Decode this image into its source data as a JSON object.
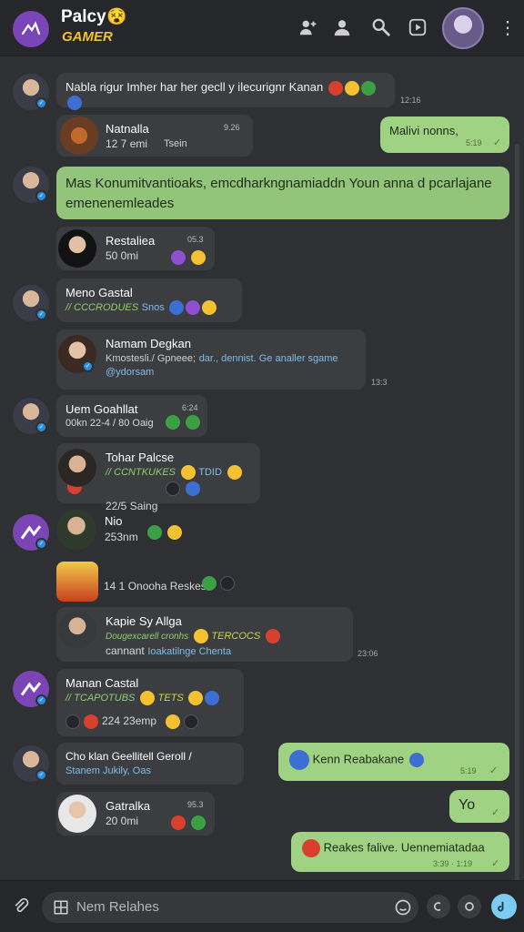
{
  "header": {
    "brand_line1": "Palcy",
    "brand_line2": "GAMER",
    "icons": [
      "add-group-icon",
      "profile-icon",
      "search-icon",
      "media-icon",
      "user-avatar",
      "more-icon"
    ]
  },
  "messages": [
    {
      "sender": "",
      "text": "Nabla rigur Imher har her gecll y ilecurignr Kanan",
      "time": "12:16"
    },
    {
      "sender": "Natnalla",
      "text": "12 7 emi",
      "extra": "Tsein",
      "time": "9.26"
    },
    {
      "sender": "",
      "text": "Malivi nonns,",
      "time": "5:19",
      "outgoing": true
    },
    {
      "sender": "",
      "text": "Mas Konumitvantioaks, emcdharkngnamiaddn Youn anna d pcarlajane emenenemleades",
      "time": ""
    },
    {
      "sender": "Restaliea",
      "text": "50 0mi",
      "time": "05.3"
    },
    {
      "sender": "Meno Gastal",
      "tag": "// CCCRODUES",
      "tag2": "Snos",
      "time": ""
    },
    {
      "sender": "Namam Degkan",
      "text": "Kmostesli./ Gpneee;",
      "link": "dar., dennist. Ge analler sgame",
      "handle": "@ydorsam",
      "time": "13:3"
    },
    {
      "sender": "Uem Goahllat",
      "text": "00kn 22-4 / 80 Oaig",
      "time": "6:24"
    },
    {
      "sender": "Tohar Palcse",
      "tag": "// CCNTKUKES",
      "tag2": "TDID",
      "text": "22/5 Saing",
      "time": ""
    },
    {
      "sender": "Nio",
      "text": "253nm",
      "time": ""
    },
    {
      "sender": "",
      "text": "14 1 Onooha Reskes",
      "time": ""
    },
    {
      "sender": "Kapie Sy Allga",
      "tag": "Dougexcarell cronhs",
      "tag2": "TERCOCS",
      "text": "cannant",
      "link": "Ioakatilnge Chenta",
      "time": "23:06"
    },
    {
      "sender": "Manan Castal",
      "tag": "// TCAPOTUBS",
      "tag2": "TETS",
      "text": "224 23emp",
      "time": ""
    },
    {
      "sender": "Cho klan Geellitell Geroll /",
      "link": "Stanem Jukily, Oas",
      "time": ""
    },
    {
      "sender": "",
      "text": "Kenn Reabakane",
      "time": "5:19",
      "outgoing": true
    },
    {
      "sender": "Gatralka",
      "text": "20 0mi",
      "time": "95.3"
    },
    {
      "sender": "",
      "text": "Yo",
      "time": "",
      "outgoing": true
    },
    {
      "sender": "",
      "text": "Reakes falive. Uennemiatadaa",
      "time": "3:39 · 1:19",
      "outgoing": true
    }
  ],
  "composer": {
    "placeholder": "Nem Relahes",
    "icons": [
      "attach-icon",
      "emoji-icon",
      "gif-icon",
      "camera-icon",
      "voice-icon"
    ]
  },
  "colors": {
    "background": "#2f3033",
    "incoming_bubble": "#3c3d41",
    "outgoing_bubble": "#9fd282",
    "accent": "#7a45b8",
    "brand_yellow": "#f2c230"
  }
}
